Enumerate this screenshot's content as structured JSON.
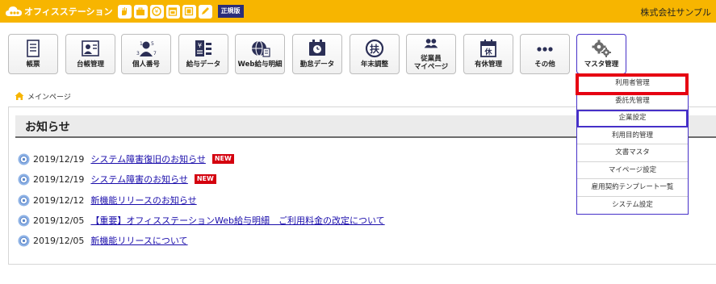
{
  "header": {
    "brand": "オフィスステーション",
    "edition": "正規版",
    "company": "株式会社サンプル"
  },
  "menu": [
    {
      "label": "帳票",
      "icon": "document-icon"
    },
    {
      "label": "台帳管理",
      "icon": "ledger-icon"
    },
    {
      "label": "個人番号",
      "icon": "my-number-icon"
    },
    {
      "label": "給与データ",
      "icon": "payroll-data-icon"
    },
    {
      "label": "Web給与明細",
      "icon": "web-payslip-icon"
    },
    {
      "label": "勤怠データ",
      "icon": "attendance-icon"
    },
    {
      "label": "年末調整",
      "icon": "year-end-adjustment-icon"
    },
    {
      "label": "従業員\nマイページ",
      "icon": "employee-icon"
    },
    {
      "label": "有休管理",
      "icon": "paid-leave-icon"
    },
    {
      "label": "その他",
      "icon": "more-icon"
    },
    {
      "label": "マスタ管理",
      "icon": "gear-icon"
    }
  ],
  "dropdown": [
    "利用者管理",
    "委託先管理",
    "企業設定",
    "利用目的管理",
    "文書マスタ",
    "マイページ設定",
    "雇用契約テンプレート一覧",
    "システム設定"
  ],
  "breadcrumb": "メインページ",
  "notices": {
    "title": "お知らせ",
    "new_label": "NEW",
    "items": [
      {
        "date": "2019/12/19",
        "text": "システム障害復旧のお知らせ",
        "new": true
      },
      {
        "date": "2019/12/19",
        "text": "システム障害のお知らせ",
        "new": true
      },
      {
        "date": "2019/12/12",
        "text": "新機能リリースのお知らせ",
        "new": false
      },
      {
        "date": "2019/12/05",
        "text": "【重要】オフィスステーションWeb給与明細　ご利用料金の改定について",
        "new": false
      },
      {
        "date": "2019/12/05",
        "text": "新機能リリースについて",
        "new": false
      }
    ]
  },
  "colors": {
    "topbar": "#f7b500",
    "accent": "#4630c8",
    "highlight": "#e60012",
    "new_badge": "#d4000e",
    "link": "#1a0dab"
  }
}
